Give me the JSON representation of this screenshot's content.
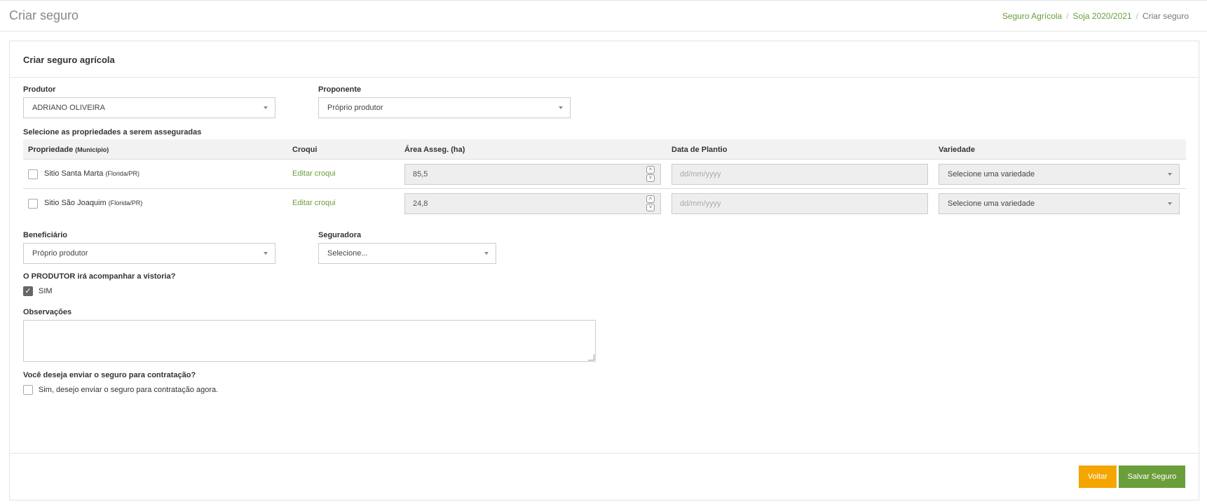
{
  "header": {
    "title": "Criar seguro",
    "breadcrumb": [
      "Seguro Agrícola",
      "Soja 2020/2021",
      "Criar seguro"
    ],
    "separator": "/"
  },
  "card": {
    "title": "Criar seguro agrícola"
  },
  "produtor": {
    "label": "Produtor",
    "value": "ADRIANO OLIVEIRA"
  },
  "proponente": {
    "label": "Proponente",
    "value": "Próprio produtor"
  },
  "propriedades": {
    "label": "Selecione as propriedades a serem asseguradas",
    "columns": {
      "propriedade": "Propriedade",
      "municipio": "(Município)",
      "croqui": "Croqui",
      "area": "Área Asseg. (ha)",
      "data": "Data de Plantio",
      "variedade": "Variedade"
    },
    "rows": [
      {
        "nome": "Sitio Santa Marta",
        "municipio": "(Florida/PR)",
        "croqui": "Editar croqui",
        "area": "85,5",
        "data_placeholder": "dd/mm/yyyy",
        "variedade": "Selecione uma variedade"
      },
      {
        "nome": "Sitio São Joaquim",
        "municipio": "(Florida/PR)",
        "croqui": "Editar croqui",
        "area": "24,8",
        "data_placeholder": "dd/mm/yyyy",
        "variedade": "Selecione uma variedade"
      }
    ]
  },
  "beneficiario": {
    "label": "Beneficiário",
    "value": "Próprio produtor"
  },
  "seguradora": {
    "label": "Seguradora",
    "value": "Selecione..."
  },
  "vistoria": {
    "label": "O PRODUTOR irá acompanhar a vistoria?",
    "option": "SIM",
    "checked": true
  },
  "observacoes": {
    "label": "Observações",
    "value": ""
  },
  "contratacao": {
    "label": "Você deseja enviar o seguro para contratação?",
    "option": "Sim, desejo enviar o seguro para contratação agora.",
    "checked": false
  },
  "buttons": {
    "back": "Voltar",
    "save": "Salvar Seguro"
  },
  "colors": {
    "accent": "#6a9e3a",
    "warning": "#f5a500"
  }
}
